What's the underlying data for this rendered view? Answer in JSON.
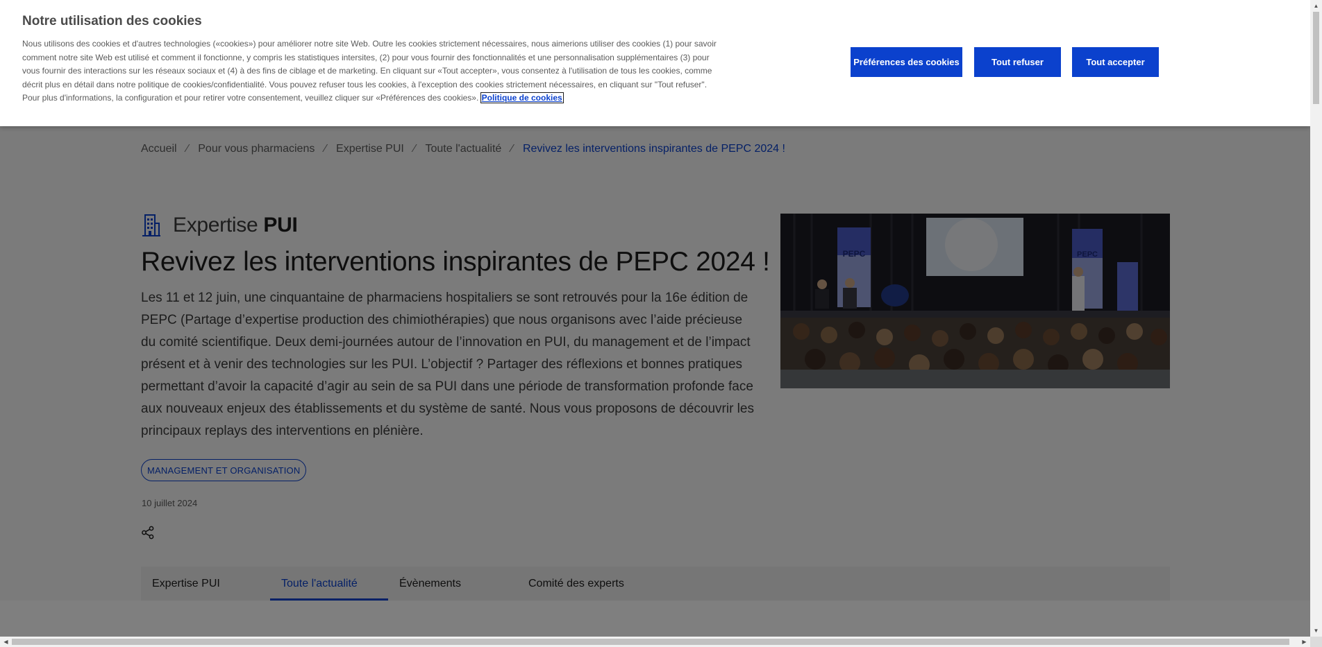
{
  "cookie_banner": {
    "title": "Notre utilisation des cookies",
    "text": "Nous utilisons des cookies et d'autres technologies («cookies») pour améliorer notre site Web. Outre les cookies strictement nécessaires, nous aimerions utiliser des cookies (1) pour savoir comment notre site Web est utilisé et comment il fonctionne, y compris les statistiques intersites, (2) pour vous fournir des fonctionnalités et une personnalisation supplémentaires (3) pour vous fournir des interactions sur les réseaux sociaux et (4) à des fins de ciblage et de marketing. En cliquant sur «Tout accepter», vous consentez à l'utilisation de tous les cookies, comme décrit plus en détail dans notre politique de cookies/confidentialité. Vous pouvez refuser tous les cookies, à l'exception des cookies strictement nécessaires, en cliquant sur \"Tout refuser\". Pour plus d'informations, la configuration et pour retirer votre consentement, veuillez cliquer sur «Préférences des cookies».",
    "policy_link": "Politique de cookies",
    "buttons": {
      "preferences": "Préférences des cookies",
      "refuse": "Tout refuser",
      "accept": "Tout accepter"
    }
  },
  "breadcrumb": {
    "items": [
      "Accueil",
      "Pour vous pharmaciens",
      "Expertise PUI",
      "Toute l'actualité"
    ],
    "current": "Revivez les interventions inspirantes de PEPC 2024 !",
    "separator": "⁄"
  },
  "article": {
    "category_prefix": "Expertise",
    "category_strong": "PUI",
    "category_icon": "hospital-building-icon",
    "title": "Revivez les interventions inspirantes de PEPC 2024 !",
    "lead": "Les 11 et 12 juin, une cinquantaine de pharmaciens hospitaliers se sont retrouvés pour la 16e édition de PEPC (Partage d’expertise production des chimiothérapies) que nous organisons avec l’aide précieuse du comité scientifique. Deux demi-journées autour de l’innovation en PUI, du management et de l’impact présent et à venir des technologies sur les PUI. L’objectif ? Partager des réflexions et bonnes pratiques permettant d’avoir la capacité d’agir au sein de sa PUI dans une période de transformation profonde face aux nouveaux enjeux des établissements et du système de santé. Nous vous proposons de découvrir les principaux replays des interventions en plénière.",
    "tag": "MANAGEMENT ET ORGANISATION",
    "date": "10 juillet 2024",
    "share_icon": "share-icon",
    "image": {
      "banner_text_left": "PEPC",
      "banner_text_right": "PEPC"
    }
  },
  "tabs": [
    {
      "label": "Expertise PUI",
      "active": false
    },
    {
      "label": "Toute l'actualité",
      "active": true
    },
    {
      "label": "Évènements",
      "active": false
    },
    {
      "label": "Comité des experts",
      "active": false
    }
  ],
  "colors": {
    "brand_blue": "#0b41cd",
    "overlay": "rgba(0,0,0,0.5)"
  }
}
